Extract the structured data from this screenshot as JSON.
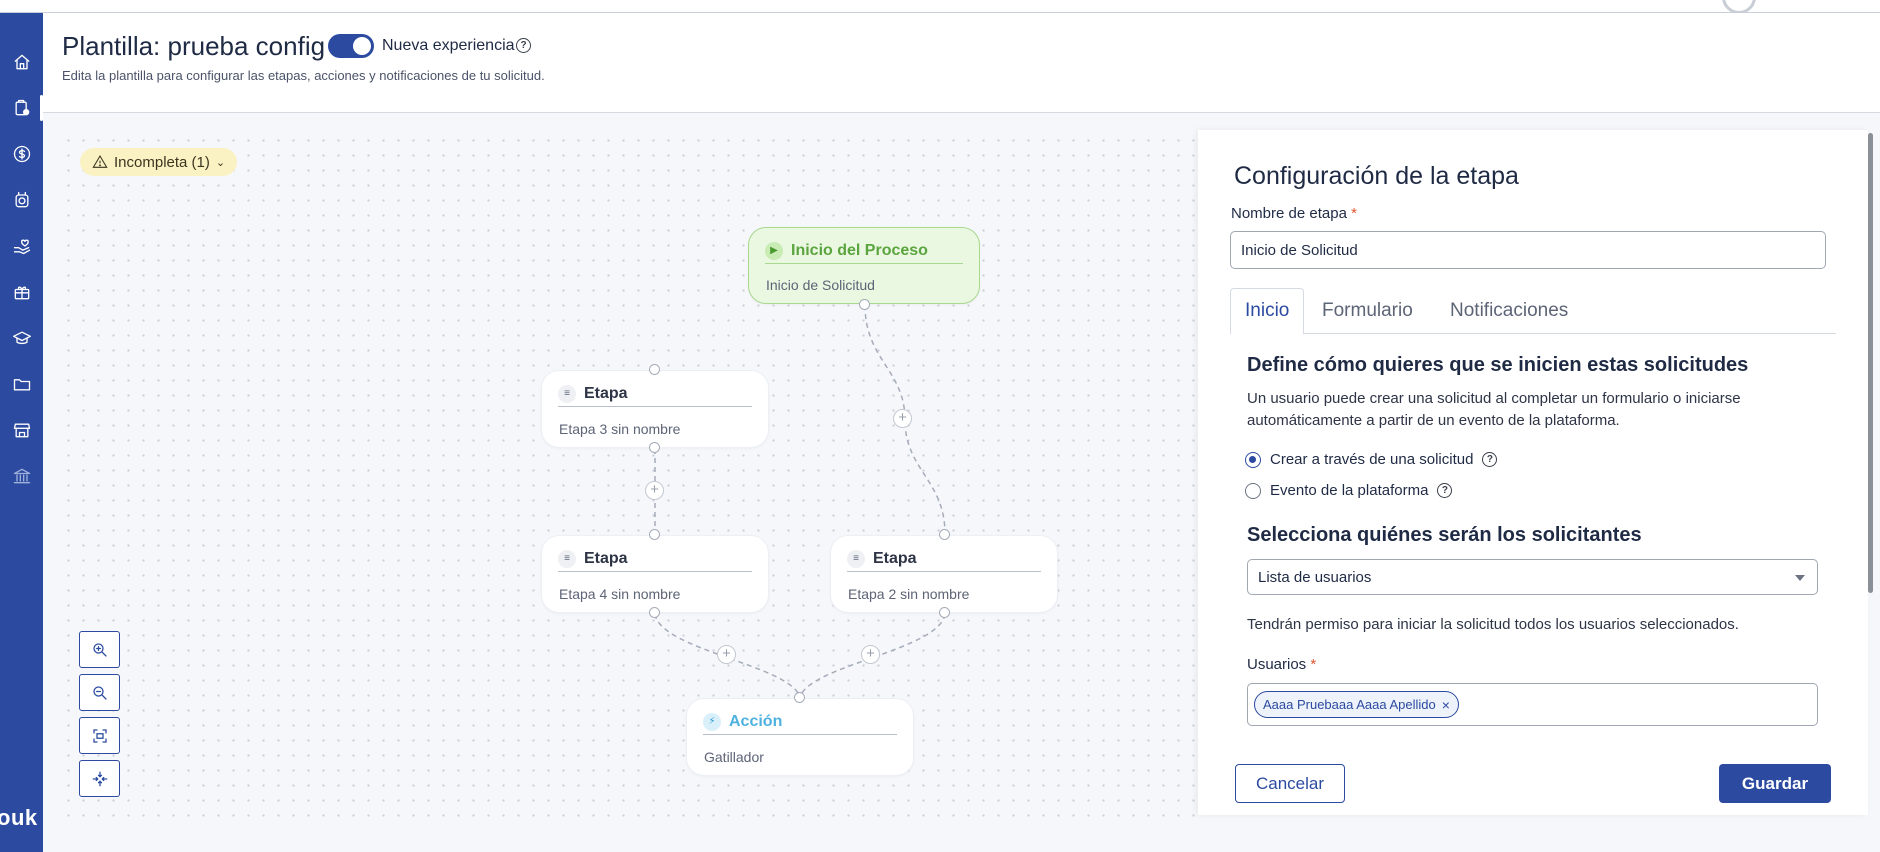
{
  "header": {
    "title": "Plantilla: prueba config",
    "toggle_label": "Nueva experiencia",
    "toggle_on": true,
    "subtitle": "Edita la plantilla para configurar las etapas, acciones y notificaciones de tu solicitud."
  },
  "sidebar": {
    "items": [
      {
        "name": "home-icon"
      },
      {
        "name": "clipboard-icon",
        "active": true
      },
      {
        "name": "dollar-icon"
      },
      {
        "name": "alarm-clock-icon"
      },
      {
        "name": "hand-heart-icon"
      },
      {
        "name": "gift-icon"
      },
      {
        "name": "graduation-cap-icon"
      },
      {
        "name": "folder-icon"
      },
      {
        "name": "store-icon"
      },
      {
        "name": "bank-icon"
      }
    ],
    "brand_partial": "ouk"
  },
  "canvas": {
    "status_chip": "Incompleta (1)",
    "nodes": {
      "start": {
        "title": "Inicio del Proceso",
        "subtitle": "Inicio de Solicitud"
      },
      "stage3": {
        "title": "Etapa",
        "subtitle": "Etapa 3 sin nombre"
      },
      "stage4": {
        "title": "Etapa",
        "subtitle": "Etapa 4 sin nombre"
      },
      "stage2": {
        "title": "Etapa",
        "subtitle": "Etapa 2 sin nombre"
      },
      "action": {
        "title": "Acción",
        "subtitle": "Gatillador"
      }
    },
    "plus_symbol": "+",
    "zoom_controls": [
      "zoom-in-icon",
      "zoom-out-icon",
      "fit-view-icon",
      "center-icon"
    ]
  },
  "panel": {
    "title": "Configuración de la etapa",
    "stage_name_label": "Nombre de etapa",
    "required_mark": "*",
    "stage_name_value": "Inicio de Solicitud",
    "tabs": [
      "Inicio",
      "Formulario",
      "Notificaciones"
    ],
    "active_tab": "Inicio",
    "section1_title": "Define cómo quieres que se inicien estas solicitudes",
    "section1_desc": "Un usuario puede crear una solicitud al completar un formulario o iniciarse automáticamente a partir de un evento de la plataforma.",
    "radio_options": [
      "Crear a través de una solicitud",
      "Evento de la plataforma"
    ],
    "radio_selected": "Crear a través de una solicitud",
    "section2_title": "Selecciona quiénes serán los solicitantes",
    "requesters_select_value": "Lista de usuarios",
    "permission_note": "Tendrán permiso para iniciar la solicitud todos los usuarios seleccionados.",
    "users_label": "Usuarios",
    "user_chip": "Aaaa Pruebaaa Aaaa Apellido",
    "chip_remove": "×",
    "cancel_label": "Cancelar",
    "save_label": "Guardar"
  },
  "colors": {
    "primary": "#2b4aa0",
    "start_node_bg": "#eaf7e1",
    "start_node_text": "#5ba53f",
    "action_text": "#4fb1e0",
    "warning_bg": "#fbf2c4"
  }
}
